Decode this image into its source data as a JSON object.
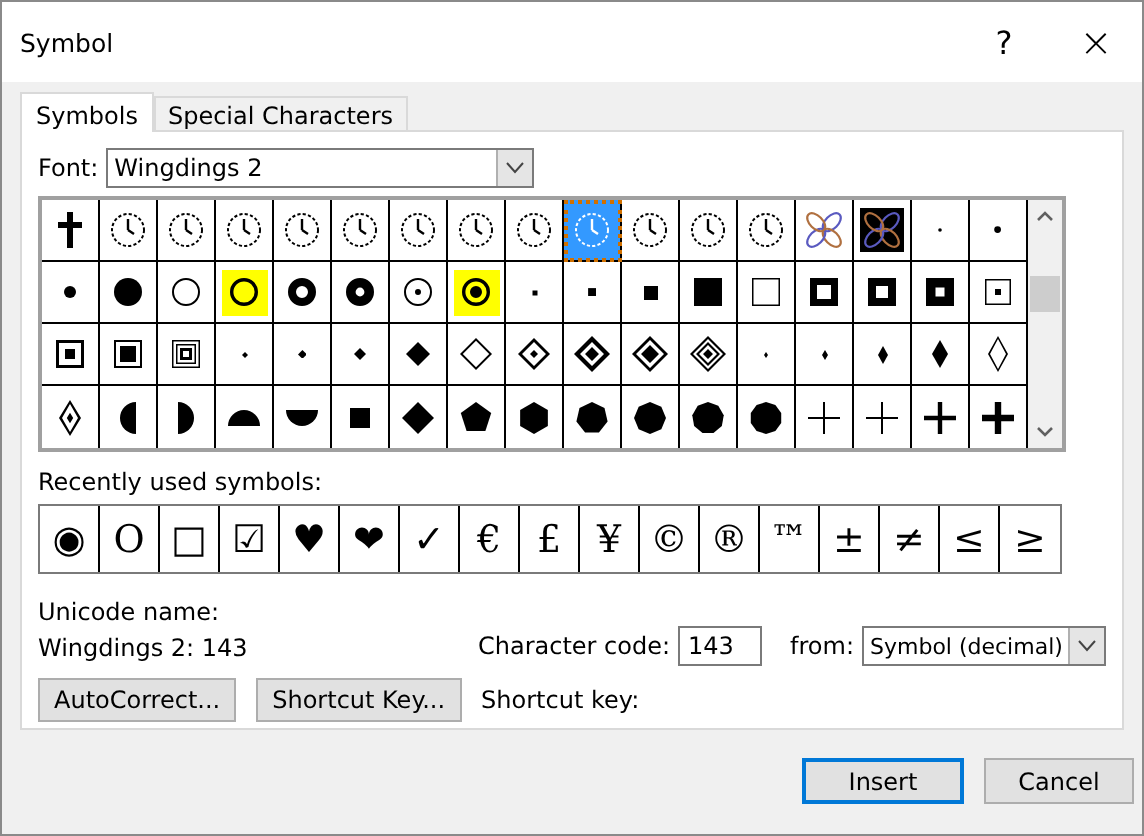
{
  "window": {
    "title": "Symbol",
    "help": "?",
    "close": "×"
  },
  "tabs": [
    {
      "label": "Symbols",
      "selected": true
    },
    {
      "label": "Special Characters",
      "selected": false
    }
  ],
  "font": {
    "label": "Font:",
    "value": "Wingdings 2"
  },
  "symbol_grid": {
    "rows": [
      {
        "cells": [
          {
            "kind": "cross",
            "selected": false,
            "highlighted": false
          },
          {
            "kind": "clock",
            "selected": false,
            "highlighted": false
          },
          {
            "kind": "clock",
            "selected": false,
            "highlighted": false
          },
          {
            "kind": "clock",
            "selected": false,
            "highlighted": false
          },
          {
            "kind": "clock",
            "selected": false,
            "highlighted": false
          },
          {
            "kind": "clock",
            "selected": false,
            "highlighted": false
          },
          {
            "kind": "clock",
            "selected": false,
            "highlighted": false
          },
          {
            "kind": "clock",
            "selected": false,
            "highlighted": false
          },
          {
            "kind": "clock",
            "selected": false,
            "highlighted": false
          },
          {
            "kind": "clock",
            "selected": true,
            "highlighted": false
          },
          {
            "kind": "clock",
            "selected": false,
            "highlighted": false
          },
          {
            "kind": "clock",
            "selected": false,
            "highlighted": false
          },
          {
            "kind": "clock",
            "selected": false,
            "highlighted": false
          },
          {
            "kind": "knot",
            "selected": false,
            "highlighted": false
          },
          {
            "kind": "knot-inverse",
            "selected": false,
            "highlighted": false
          },
          {
            "kind": "dot-tiny",
            "selected": false,
            "highlighted": false
          },
          {
            "kind": "dot-small",
            "selected": false,
            "highlighted": false
          }
        ]
      },
      {
        "cells": [
          {
            "kind": "dot-medium",
            "selected": false,
            "highlighted": false
          },
          {
            "kind": "disc",
            "selected": false,
            "highlighted": false
          },
          {
            "kind": "circle",
            "selected": false,
            "highlighted": false
          },
          {
            "kind": "circle-bold",
            "selected": false,
            "highlighted": true
          },
          {
            "kind": "ring",
            "selected": false,
            "highlighted": false
          },
          {
            "kind": "ring-thick",
            "selected": false,
            "highlighted": false
          },
          {
            "kind": "circle-dot",
            "selected": false,
            "highlighted": false
          },
          {
            "kind": "circle-dot-bold",
            "selected": false,
            "highlighted": true
          },
          {
            "kind": "square-tiny",
            "selected": false,
            "highlighted": false
          },
          {
            "kind": "square-small",
            "selected": false,
            "highlighted": false
          },
          {
            "kind": "square",
            "selected": false,
            "highlighted": false
          },
          {
            "kind": "square-large",
            "selected": false,
            "highlighted": false
          },
          {
            "kind": "square-outline",
            "selected": false,
            "highlighted": false
          },
          {
            "kind": "frame",
            "selected": false,
            "highlighted": false
          },
          {
            "kind": "frame-thick",
            "selected": false,
            "highlighted": false
          },
          {
            "kind": "frame-heavy",
            "selected": false,
            "highlighted": false
          },
          {
            "kind": "square-dot",
            "selected": false,
            "highlighted": false
          }
        ]
      },
      {
        "cells": [
          {
            "kind": "square-dot-framed",
            "selected": false,
            "highlighted": false
          },
          {
            "kind": "square-in-square",
            "selected": false,
            "highlighted": false
          },
          {
            "kind": "squares-concentric",
            "selected": false,
            "highlighted": false
          },
          {
            "kind": "diamond-tiny",
            "selected": false,
            "highlighted": false
          },
          {
            "kind": "diamond-small",
            "selected": false,
            "highlighted": false
          },
          {
            "kind": "diamond-medium",
            "selected": false,
            "highlighted": false
          },
          {
            "kind": "diamond",
            "selected": false,
            "highlighted": false
          },
          {
            "kind": "diamond-outline",
            "selected": false,
            "highlighted": false
          },
          {
            "kind": "diamond-dot",
            "selected": false,
            "highlighted": false
          },
          {
            "kind": "diamond-dot-bold",
            "selected": false,
            "highlighted": false
          },
          {
            "kind": "diamond-in-diamond",
            "selected": false,
            "highlighted": false
          },
          {
            "kind": "diamonds-concentric",
            "selected": false,
            "highlighted": false
          },
          {
            "kind": "lozenge-tiny",
            "selected": false,
            "highlighted": false
          },
          {
            "kind": "lozenge-small",
            "selected": false,
            "highlighted": false
          },
          {
            "kind": "lozenge",
            "selected": false,
            "highlighted": false
          },
          {
            "kind": "lozenge-large",
            "selected": false,
            "highlighted": false
          },
          {
            "kind": "lozenge-outline",
            "selected": false,
            "highlighted": false
          }
        ]
      },
      {
        "cells": [
          {
            "kind": "lozenge-dot",
            "selected": false,
            "highlighted": false
          },
          {
            "kind": "half-left",
            "selected": false,
            "highlighted": false
          },
          {
            "kind": "half-right",
            "selected": false,
            "highlighted": false
          },
          {
            "kind": "half-top",
            "selected": false,
            "highlighted": false
          },
          {
            "kind": "half-bottom",
            "selected": false,
            "highlighted": false
          },
          {
            "kind": "square-medium",
            "selected": false,
            "highlighted": false
          },
          {
            "kind": "diamond-large",
            "selected": false,
            "highlighted": false
          },
          {
            "kind": "pentagon",
            "selected": false,
            "highlighted": false
          },
          {
            "kind": "hexagon",
            "selected": false,
            "highlighted": false
          },
          {
            "kind": "heptagon",
            "selected": false,
            "highlighted": false
          },
          {
            "kind": "octagon",
            "selected": false,
            "highlighted": false
          },
          {
            "kind": "nonagon",
            "selected": false,
            "highlighted": false
          },
          {
            "kind": "decagon",
            "selected": false,
            "highlighted": false
          },
          {
            "kind": "plus-thin",
            "selected": false,
            "highlighted": false
          },
          {
            "kind": "plus-thin",
            "selected": false,
            "highlighted": false
          },
          {
            "kind": "plus",
            "selected": false,
            "highlighted": false
          },
          {
            "kind": "plus-bold",
            "selected": false,
            "highlighted": false
          }
        ]
      }
    ]
  },
  "recent": {
    "label": "Recently used symbols:",
    "symbols": [
      "◉",
      "O",
      "□",
      "☑",
      "♥",
      "❤",
      "✓",
      "€",
      "£",
      "¥",
      "©",
      "®",
      "™",
      "±",
      "≠",
      "≤",
      "≥"
    ]
  },
  "unicode_name": {
    "label": "Unicode name:",
    "value": "Wingdings 2: 143"
  },
  "character_code": {
    "label": "Character code:",
    "value": "143"
  },
  "from": {
    "label": "from:",
    "value": "Symbol (decimal)"
  },
  "buttons": [
    "AutoCorrect...",
    "Shortcut Key..."
  ],
  "shortcut_key": {
    "label": "Shortcut key:"
  },
  "footer_buttons": [
    {
      "label": "Insert",
      "default": true
    },
    {
      "label": "Cancel",
      "default": false
    }
  ]
}
